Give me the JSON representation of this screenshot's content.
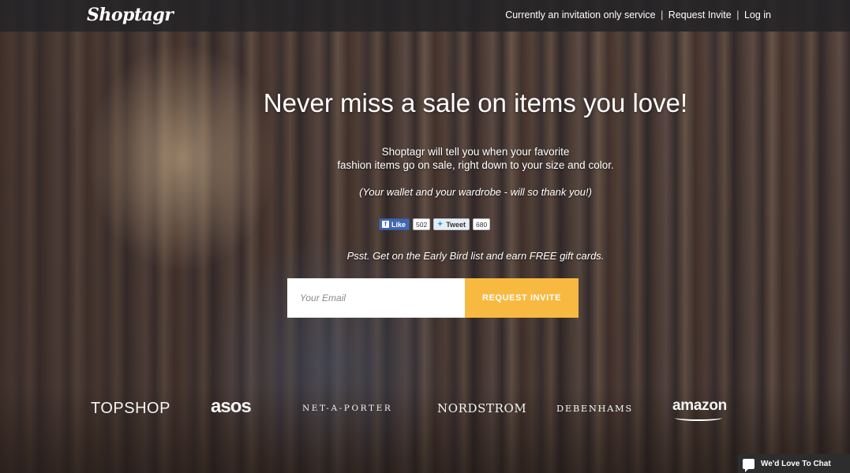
{
  "header": {
    "logo": "Shoptagr",
    "status_text": "Currently an invitation only service",
    "sep1": "|",
    "request_invite": "Request Invite",
    "sep2": "|",
    "log_in": "Log in"
  },
  "hero": {
    "headline": "Never miss a sale on items you love!",
    "desc_line1": "Shoptagr will tell you when your favorite",
    "desc_line2": "fashion items go on sale, right down to your size and color.",
    "tagline": "(Your wallet and your wardrobe - will so thank you!)",
    "psst": "Psst. Get on the Early Bird list and earn FREE gift cards."
  },
  "social": {
    "like_label": "Like",
    "like_count": "502",
    "tweet_label": "Tweet",
    "tweet_count": "680"
  },
  "signup": {
    "email_placeholder": "Your Email",
    "submit_label": "REQUEST INVITE"
  },
  "brands": [
    "TOPSHOP",
    "asos",
    "NET-A-PORTER",
    "NORDSTROM",
    "DEBENHAMS",
    "amazon"
  ],
  "chat": {
    "label": "We'd Love To Chat"
  },
  "colors": {
    "accent": "#f8b941",
    "topbar": "#232326",
    "facebook": "#4267b2"
  }
}
